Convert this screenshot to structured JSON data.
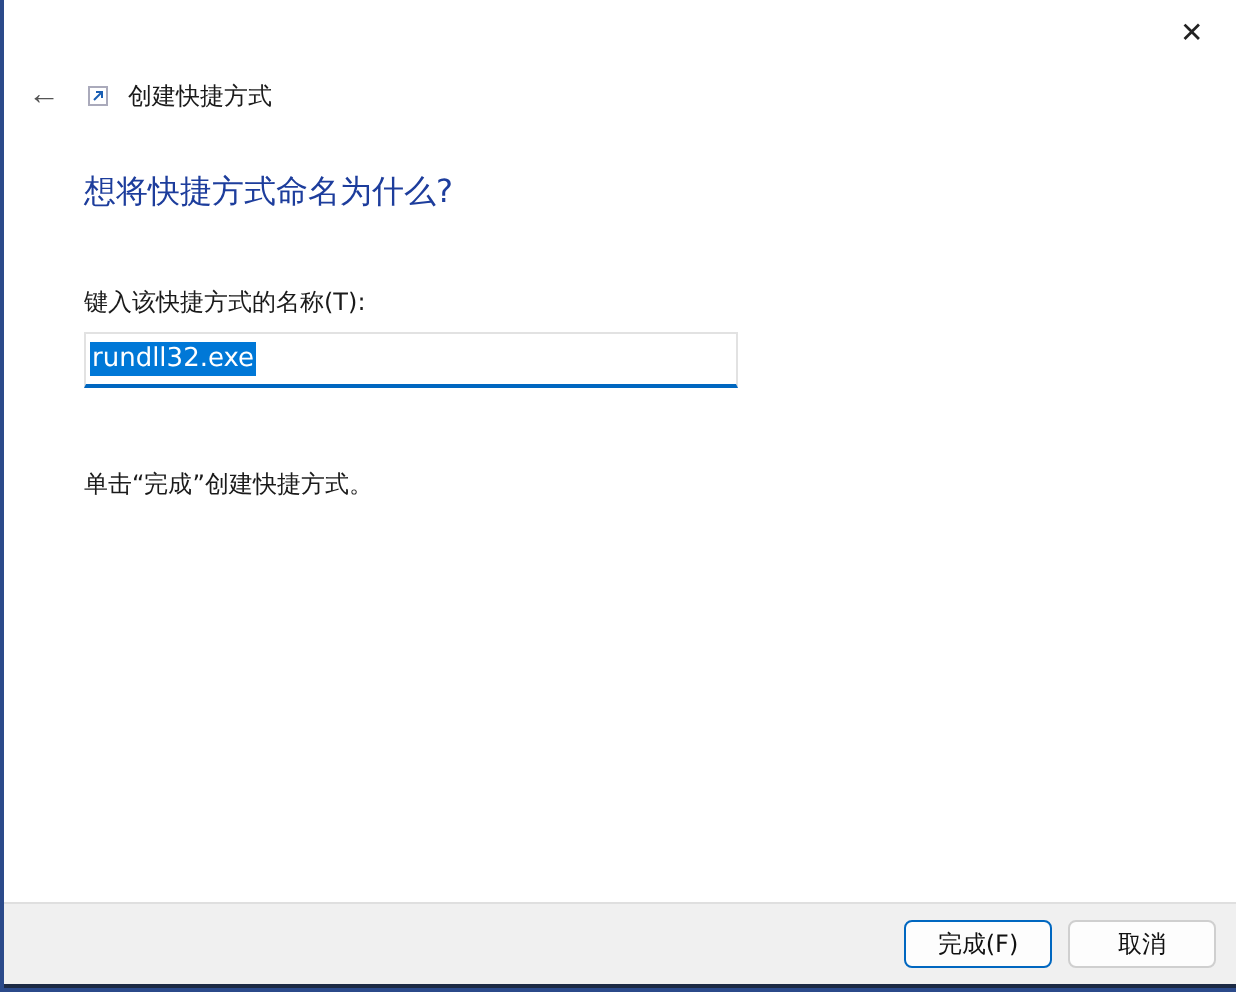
{
  "window": {
    "title": "创建快捷方式",
    "close": "✕",
    "back": "←"
  },
  "heading": "想将快捷方式命名为什么?",
  "name_field": {
    "label": "键入该快捷方式的名称(T):",
    "value": "rundll32.exe",
    "selected": true
  },
  "hint": "单击“完成”创建快捷方式。",
  "buttons": [
    {
      "label": "完成(F)",
      "default": true
    },
    {
      "label": "取消",
      "default": false
    }
  ]
}
